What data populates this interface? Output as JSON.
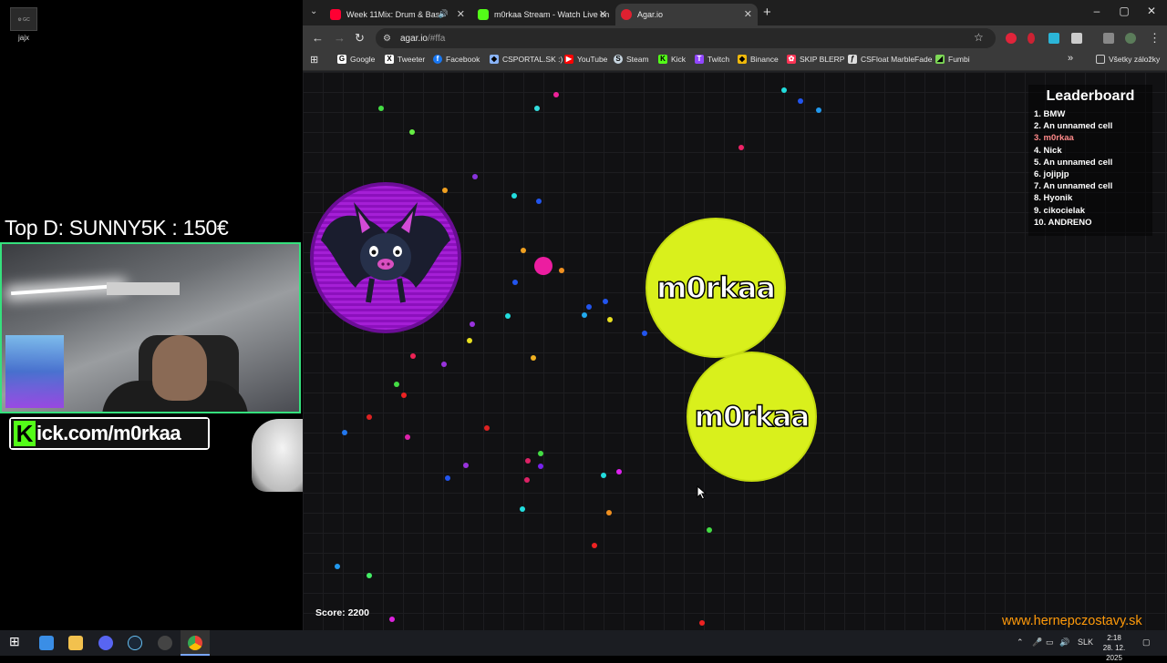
{
  "desktop": {
    "icon_label": "jajx",
    "icon_thumb_text": "⚙ GC"
  },
  "stream_overlay": {
    "top_donor": "Top D: SUNNY5K : 150€",
    "kick_letter": "K",
    "kick_text": "ick.com/m0rkaa",
    "webcam_border_color": "#35e07d"
  },
  "browser": {
    "tabs": [
      {
        "title": "Week 11Mix: Drum & Bass",
        "favicon_color": "#ff0033",
        "muted_icon": "speaker-icon"
      },
      {
        "title": "m0rkaa Stream - Watch Live on",
        "favicon_color": "#53fc18"
      },
      {
        "title": "Agar.io",
        "favicon_color": "#e02030"
      }
    ],
    "new_tab_label": "+",
    "window_controls": [
      "–",
      "▢",
      "✕"
    ],
    "address": {
      "host": "agar.io",
      "path": "/#ffa"
    },
    "bookmarks": [
      {
        "label": "Google",
        "icon_color": "#ffffff",
        "icon": "G"
      },
      {
        "label": "Tweeter",
        "icon_color": "#ffffff",
        "icon": "X"
      },
      {
        "label": "Facebook",
        "icon_color": "#1877f2",
        "icon": "f"
      },
      {
        "label": "CSPORTAL.SK :)",
        "icon_color": "#8ab4f8",
        "icon": "◆"
      },
      {
        "label": "YouTube",
        "icon_color": "#ff0000",
        "icon": "▶"
      },
      {
        "label": "Steam",
        "icon_color": "#c7d5e0",
        "icon": "S"
      },
      {
        "label": "Kick",
        "icon_color": "#53fc18",
        "icon": "K"
      },
      {
        "label": "Twitch",
        "icon_color": "#9146ff",
        "icon": "T"
      },
      {
        "label": "Binance",
        "icon_color": "#f0b90b",
        "icon": "◆"
      },
      {
        "label": "SKIP BLERP",
        "icon_color": "#ff3355",
        "icon": "✿"
      },
      {
        "label": "CSFloat MarbleFade",
        "icon_color": "#dddddd",
        "icon": "ƒ"
      },
      {
        "label": "Fumbi",
        "icon_color": "#7ed957",
        "icon": "◢"
      }
    ],
    "all_bookmarks_label": "Všetky záložky"
  },
  "game": {
    "leaderboard_title": "Leaderboard",
    "leaderboard": [
      {
        "rank": "1.",
        "name": "BMW",
        "me": false
      },
      {
        "rank": "2.",
        "name": "An unnamed cell",
        "me": false
      },
      {
        "rank": "3.",
        "name": "m0rkaa",
        "me": true
      },
      {
        "rank": "4.",
        "name": "Nick",
        "me": false
      },
      {
        "rank": "5.",
        "name": "An unnamed cell",
        "me": false
      },
      {
        "rank": "6.",
        "name": "jojipjp",
        "me": false
      },
      {
        "rank": "7.",
        "name": "An unnamed cell",
        "me": false
      },
      {
        "rank": "8.",
        "name": "Hyonik",
        "me": false
      },
      {
        "rank": "9.",
        "name": "cikocielak",
        "me": false
      },
      {
        "rank": "10.",
        "name": "ANDRENO",
        "me": false
      }
    ],
    "player_name": "m0rkaa",
    "score": "Score: 2200",
    "player_color": "#d9f01c",
    "enemy_color": "#a51fd6"
  },
  "watermark": "www.hernepczostavy.sk",
  "taskbar": {
    "language": "SLK",
    "time": "2:18",
    "date": "28. 12. 2025"
  }
}
